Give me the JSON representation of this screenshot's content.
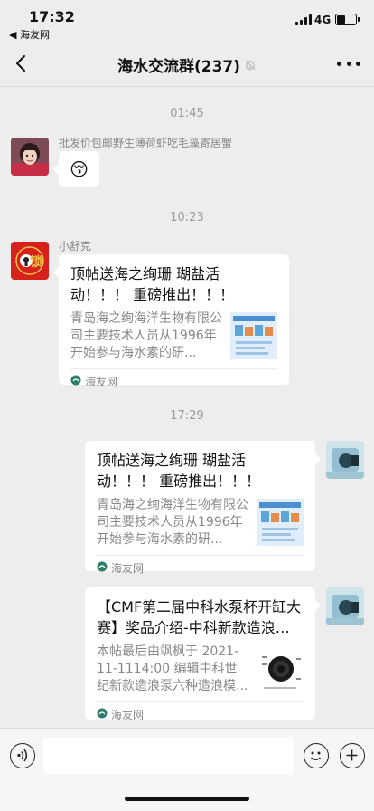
{
  "status_bar": {
    "time": "17:32",
    "back_app": "◀ 海友网",
    "network": "4G",
    "battery_level": 0.45
  },
  "nav": {
    "title": "海水交流群(237)",
    "icons": [
      "back-chevron-icon",
      "mute-bell-icon",
      "more-dots-icon"
    ]
  },
  "messages": {
    "time1": "01:45",
    "msg1": {
      "sender": "批发价包邮野生薄荷虾吃毛藻寄居蟹",
      "emoji": "😚"
    },
    "time2": "10:23",
    "msg2": {
      "sender": "小舒克",
      "title": "顶帖送海之绚珊 瑚盐活动！！！ 重磅推出！！！",
      "desc": "青岛海之绚海洋生物有限公司主要技术人员从1996年开始参与海水素的研...",
      "source": "海友网"
    },
    "time3": "17:29",
    "msg3": {
      "title": "顶帖送海之绚珊 瑚盐活动！！！ 重磅推出！！！",
      "desc": "青岛海之绚海洋生物有限公司主要技术人员从1996年开始参与海水素的研...",
      "source": "海友网"
    },
    "msg4": {
      "title": "【CMF第二届中科水泵杯开缸大赛】奖品介绍-中科新款造浪泵...",
      "desc": "本帖最后由飒枫于 2021-11-1114:00 编辑中科世纪新款造浪泵六种造浪模...",
      "source": "海友网"
    }
  },
  "input_bar": {
    "placeholder": "",
    "icons": [
      "voice-icon",
      "emoji-icon",
      "plus-icon"
    ]
  },
  "colors": {
    "chat_background": "#ededed",
    "bubble": "#ffffff",
    "muted_text": "#888888"
  }
}
